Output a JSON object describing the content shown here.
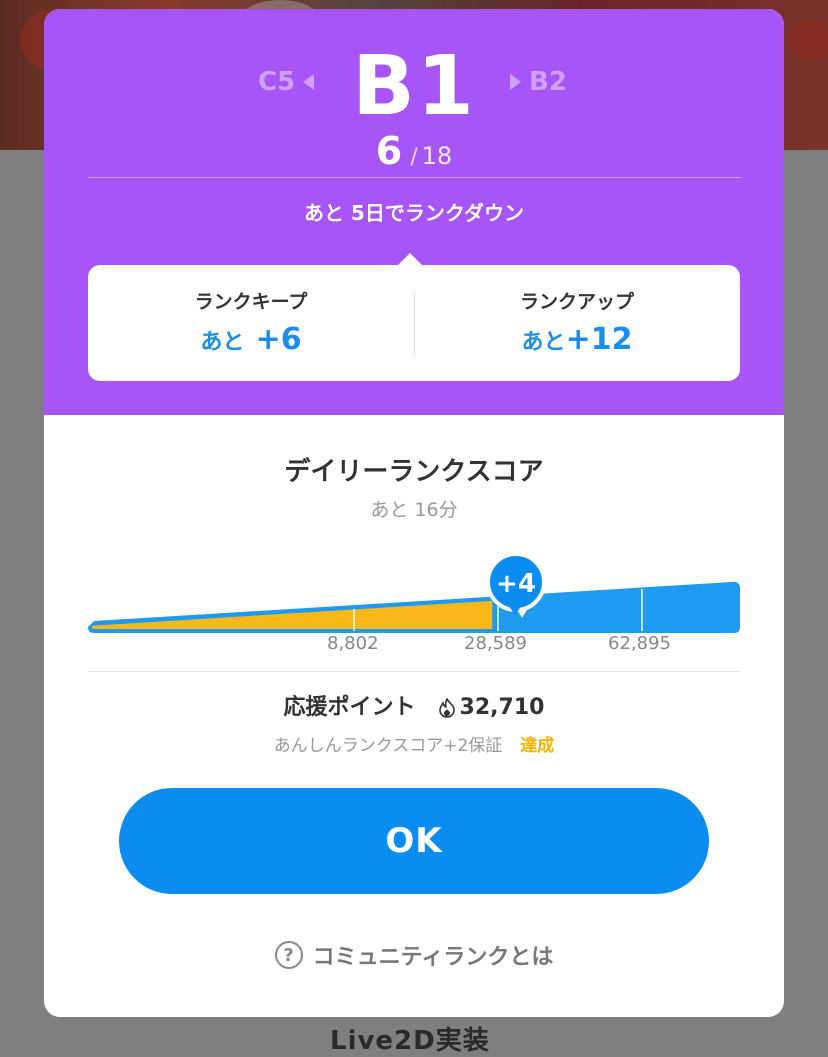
{
  "rank": {
    "prev": "C5",
    "current": "B1",
    "next": "B2",
    "position": "6",
    "separator": "/",
    "total": "18",
    "down_message": "あと 5日でランクダウン"
  },
  "keep": {
    "label": "ランクキープ",
    "prefix": "あと",
    "value": "+6"
  },
  "up": {
    "label": "ランクアップ",
    "prefix": "あと",
    "value": "+12"
  },
  "daily": {
    "title": "デイリーランクスコア",
    "remaining": "あと 16分",
    "badge": "+4",
    "progress_fraction": 0.62,
    "thresholds": [
      "8,802",
      "28,589",
      "62,895"
    ],
    "fill_color": "#fbb81b",
    "bar_color": "#1e9af0"
  },
  "support": {
    "label": "応援ポイント",
    "value": "32,710",
    "icon": "flame-icon",
    "guarantee_text": "あんしんランクスコア+2保証",
    "guarantee_status": "達成"
  },
  "buttons": {
    "ok": "OK"
  },
  "help": {
    "label": "コミュニティランクとは",
    "icon": "question-icon"
  },
  "background": {
    "bottom_text": "Live2D実装"
  },
  "colors": {
    "header": "#a855f7",
    "accent": "#1a8ee8",
    "button": "#0a8cf0",
    "success": "#f4b400"
  }
}
